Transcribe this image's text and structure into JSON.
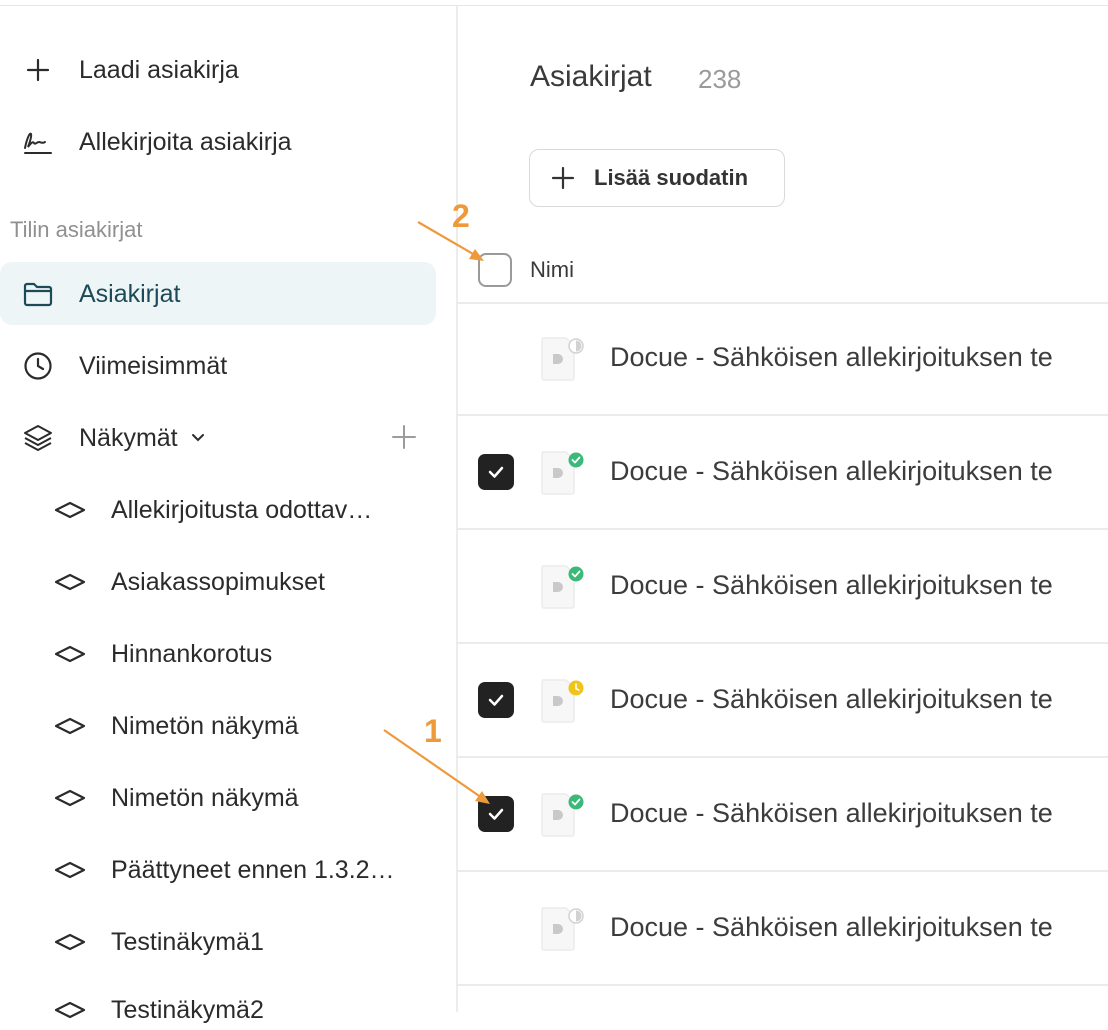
{
  "sidebar": {
    "actions": [
      {
        "label": "Laadi asiakirja",
        "icon": "plus-icon"
      },
      {
        "label": "Allekirjoita asiakirja",
        "icon": "signature-icon"
      }
    ],
    "section_label": "Tilin asiakirjat",
    "nav": [
      {
        "label": "Asiakirjat",
        "icon": "folder-icon",
        "active": true
      },
      {
        "label": "Viimeisimmät",
        "icon": "clock-icon",
        "active": false
      },
      {
        "label": "Näkymät",
        "icon": "layers-icon",
        "active": false
      }
    ],
    "views": [
      {
        "label": "Allekirjoitusta odottav…"
      },
      {
        "label": "Asiakassopimukset"
      },
      {
        "label": "Hinnankorotus"
      },
      {
        "label": "Nimetön näkymä"
      },
      {
        "label": "Nimetön näkymä"
      },
      {
        "label": "Päättyneet ennen 1.3.2…"
      },
      {
        "label": "Testinäkymä1"
      },
      {
        "label": "Testinäkymä2"
      }
    ]
  },
  "main": {
    "title": "Asiakirjat",
    "count": "238",
    "filter_button": "Lisää suodatin",
    "column_name": "Nimi",
    "rows": [
      {
        "name": "Docue - Sähköisen allekirjoituksen te",
        "checked": false,
        "status": "half"
      },
      {
        "name": "Docue - Sähköisen allekirjoituksen te",
        "checked": true,
        "status": "signed"
      },
      {
        "name": "Docue - Sähköisen allekirjoituksen te",
        "checked": false,
        "status": "signed"
      },
      {
        "name": "Docue - Sähköisen allekirjoituksen te",
        "checked": true,
        "status": "pending"
      },
      {
        "name": "Docue - Sähköisen allekirjoituksen te",
        "checked": true,
        "status": "signed"
      },
      {
        "name": "Docue - Sähköisen allekirjoituksen te",
        "checked": false,
        "status": "half"
      }
    ]
  },
  "annotations": {
    "label_1": "1",
    "label_2": "2",
    "color": "#ef9a3a"
  },
  "colors": {
    "active_bg": "#eef5f7",
    "active_text": "#1c4a58",
    "status_green": "#3cb878",
    "status_yellow": "#f0c419"
  }
}
